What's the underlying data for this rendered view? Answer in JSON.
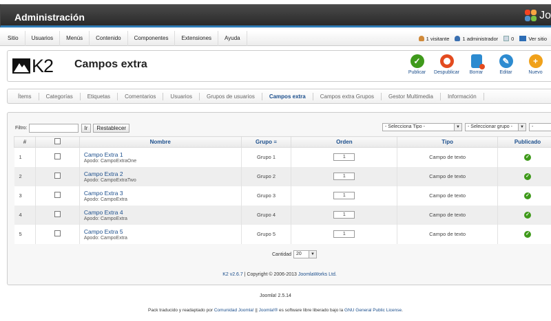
{
  "header": {
    "title": "Administración",
    "logo_text": "Jo"
  },
  "menu": [
    "Sitio",
    "Usuarios",
    "Menús",
    "Contenido",
    "Componentes",
    "Extensiones",
    "Ayuda"
  ],
  "status": {
    "visitors": "1 visitante",
    "admins": "1 administrador",
    "messages": "0",
    "view_site": "Ver sitio"
  },
  "k2": {
    "logo": "K2",
    "page_title": "Campos extra"
  },
  "toolbar": [
    {
      "label": "Publicar",
      "icon": "check-icon",
      "color": "#3f9a1b"
    },
    {
      "label": "Despublicar",
      "icon": "unpublish-icon",
      "color": "#e34b1f"
    },
    {
      "label": "Borrar",
      "icon": "trash-icon",
      "color": "#2d8bd0"
    },
    {
      "label": "Editar",
      "icon": "pencil-icon",
      "color": "#2d8bd0"
    },
    {
      "label": "Nuevo",
      "icon": "plus-icon",
      "color": "#f0a11a"
    }
  ],
  "tabs": [
    "Ítems",
    "Categorías",
    "Etiquetas",
    "Comentarios",
    "Usuarios",
    "Grupos de usuarios",
    "Campos extra",
    "Campos extra Grupos",
    "Gestor Multimedia",
    "Información"
  ],
  "active_tab": "Campos extra",
  "filter": {
    "label": "Filtro:",
    "go": "Ir",
    "reset": "Restablecer",
    "type_select": "- Selecciona Tipo -",
    "group_select": "- Seleccionar grupo -",
    "state_select": "- Selecciona"
  },
  "columns": {
    "num": "#",
    "name": "Nombre",
    "group": "Grupo",
    "order": "Orden",
    "type": "Tipo",
    "published": "Publicado"
  },
  "rows": [
    {
      "num": "1",
      "name": "Campo Extra 1",
      "alias": "Apodo: CampoExtraOne",
      "group": "Grupo 1",
      "order": "1",
      "type": "Campo de texto"
    },
    {
      "num": "2",
      "name": "Campo Extra 2",
      "alias": "Apodo: CampoExtraTwo",
      "group": "Grupo 2",
      "order": "1",
      "type": "Campo de texto"
    },
    {
      "num": "3",
      "name": "Campo Extra 3",
      "alias": "Apodo: CampoExtra",
      "group": "Grupo 3",
      "order": "1",
      "type": "Campo de texto"
    },
    {
      "num": "4",
      "name": "Campo Extra 4",
      "alias": "Apodo: CampoExtra",
      "group": "Grupo 4",
      "order": "1",
      "type": "Campo de texto"
    },
    {
      "num": "5",
      "name": "Campo Extra 5",
      "alias": "Apodo: CampoExtra",
      "group": "Grupo 5",
      "order": "1",
      "type": "Campo de texto"
    }
  ],
  "pagination": {
    "label": "Cantidad",
    "value": "20"
  },
  "copyright": {
    "version": "K2 v2.6.7",
    "text": " | Copyright © 2006-2013 ",
    "company": "JoomlaWorks Ltd."
  },
  "footer": {
    "joomla_version": "Joomla! 2.5.14",
    "line_prefix": "Pack traducido y readaptado por ",
    "community": "Comunidad Joomla!",
    "sep": " || ",
    "joomla": "Joomla!®",
    "middle": " es software libre liberado bajo la ",
    "license": "GNU General Public License",
    "end": "."
  }
}
